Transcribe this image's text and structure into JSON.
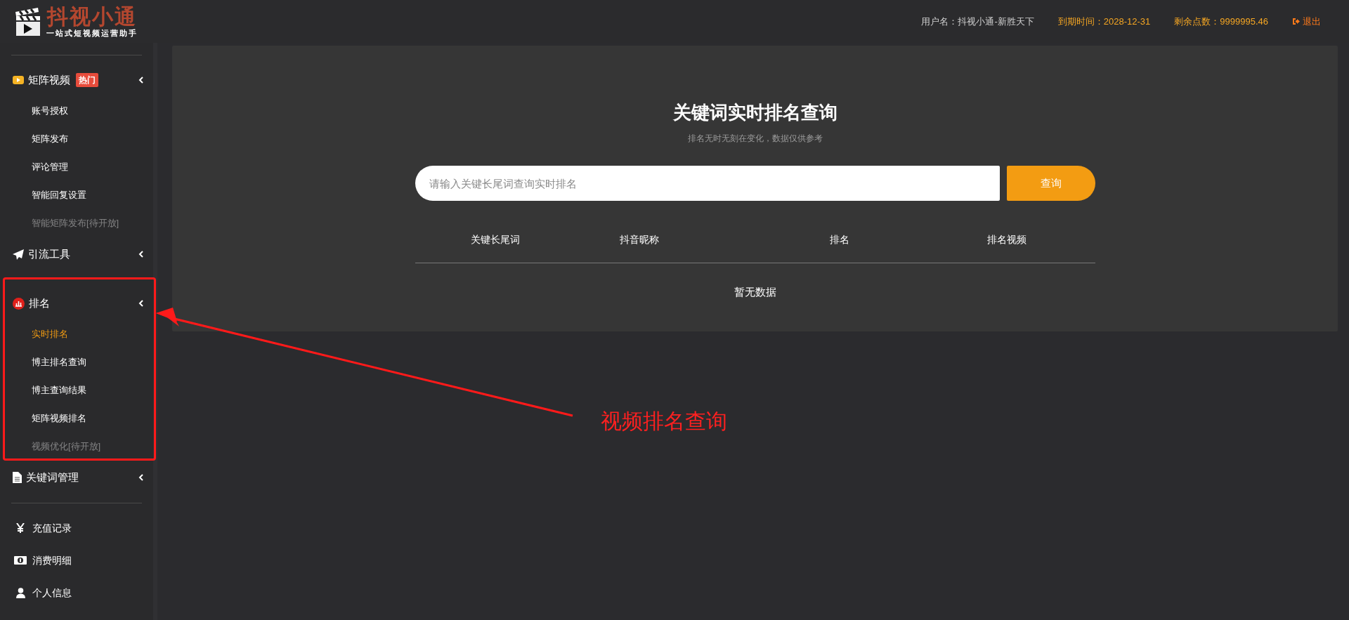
{
  "header": {
    "logo": {
      "name": "抖视小通",
      "tagline": "一站式短视频运营助手"
    },
    "user": "用户名：抖视小通-新胜天下",
    "expiry": "到期时间：2028-12-31",
    "points": "剩余点数：9999995.46",
    "logout": "退出"
  },
  "sidebar": {
    "groups": [
      {
        "label": "矩阵视频",
        "badge": "热门",
        "children": [
          {
            "label": "账号授权",
            "selected": false,
            "disabled": false
          },
          {
            "label": "矩阵发布",
            "selected": false,
            "disabled": false
          },
          {
            "label": "评论管理",
            "selected": false,
            "disabled": false
          },
          {
            "label": "智能回复设置",
            "selected": false,
            "disabled": false
          },
          {
            "label": "智能矩阵发布[待开放]",
            "selected": false,
            "disabled": true
          }
        ]
      },
      {
        "label": "引流工具"
      },
      {
        "label": "排名",
        "children": [
          {
            "label": "实时排名",
            "selected": true,
            "disabled": false
          },
          {
            "label": "博主排名查询",
            "selected": false,
            "disabled": false
          },
          {
            "label": "博主查询结果",
            "selected": false,
            "disabled": false
          },
          {
            "label": "矩阵视频排名",
            "selected": false,
            "disabled": false
          },
          {
            "label": "视频优化[待开放]",
            "selected": false,
            "disabled": true
          }
        ]
      },
      {
        "label": "关键词管理"
      }
    ],
    "links": [
      {
        "label": "充值记录"
      },
      {
        "label": "消费明细"
      },
      {
        "label": "个人信息"
      }
    ]
  },
  "panel": {
    "title": "关键词实时排名查询",
    "subtitle": "排名无时无刻在变化，数据仅供参考",
    "search": {
      "placeholder": "请输入关键长尾词查询实时排名"
    },
    "button": "查询",
    "table": {
      "columns": [
        "关键长尾词",
        "抖音昵称",
        "排名",
        "排名视频"
      ],
      "empty": "暂无数据"
    }
  },
  "annotation": {
    "text": "视频排名查询"
  }
}
